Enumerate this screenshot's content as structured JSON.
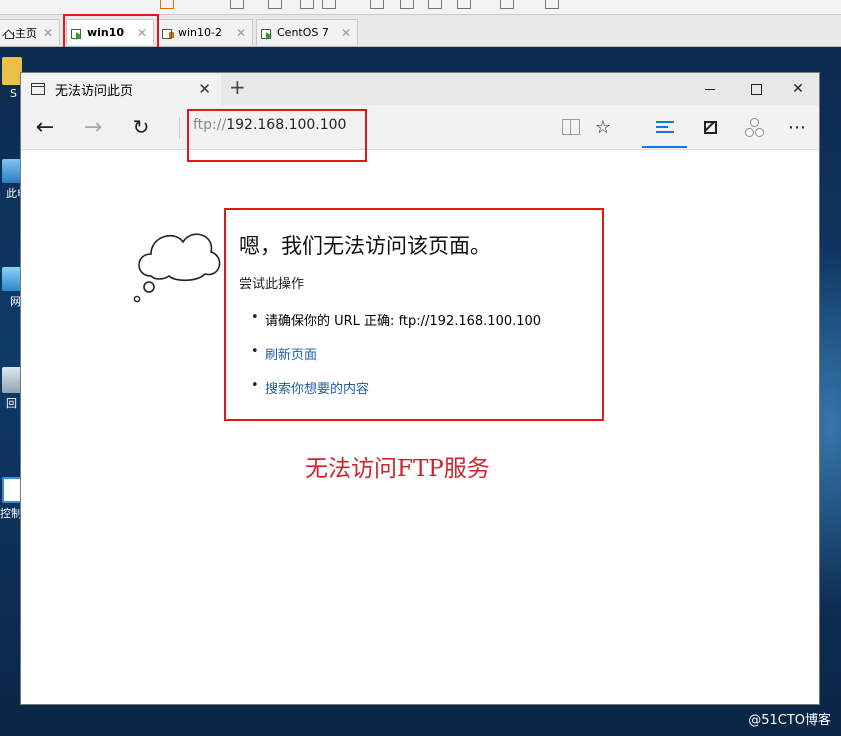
{
  "vm_tabs": [
    {
      "label": "主页",
      "icon": "home-icon"
    },
    {
      "label": "win10",
      "icon": "vm-running-icon",
      "active": true
    },
    {
      "label": "win10-2",
      "icon": "vm-paused-icon"
    },
    {
      "label": "CentOS 7",
      "icon": "vm-running-icon"
    }
  ],
  "desktop": {
    "icons": [
      {
        "label": "S",
        "icon": "folder-icon"
      },
      {
        "label": "此电",
        "icon": "this-pc-icon"
      },
      {
        "label": "网",
        "icon": "network-icon"
      },
      {
        "label": "回",
        "icon": "recycle-bin-icon"
      },
      {
        "label": "控制",
        "icon": "control-panel-icon"
      }
    ],
    "watermark": "@51CTO博客"
  },
  "browser": {
    "tab_title": "无法访问此页",
    "new_tab": "+",
    "address": {
      "scheme": "ftp://",
      "host": "192.168.100.100"
    },
    "error": {
      "title": "嗯，我们无法访问该页面。",
      "subtitle": "尝试此操作",
      "items": [
        {
          "text": "请确保你的 URL 正确: ftp://192.168.100.100",
          "link": false
        },
        {
          "text": "刷新页面",
          "link": true
        },
        {
          "text": "搜索你想要的内容",
          "link": true
        }
      ]
    },
    "caption": "无法访问FTP服务"
  },
  "colors": {
    "annotation_red": "#e01818",
    "caption_red": "#d2232a",
    "link_blue": "#1f5fa8",
    "accent": "#1a73d6"
  }
}
